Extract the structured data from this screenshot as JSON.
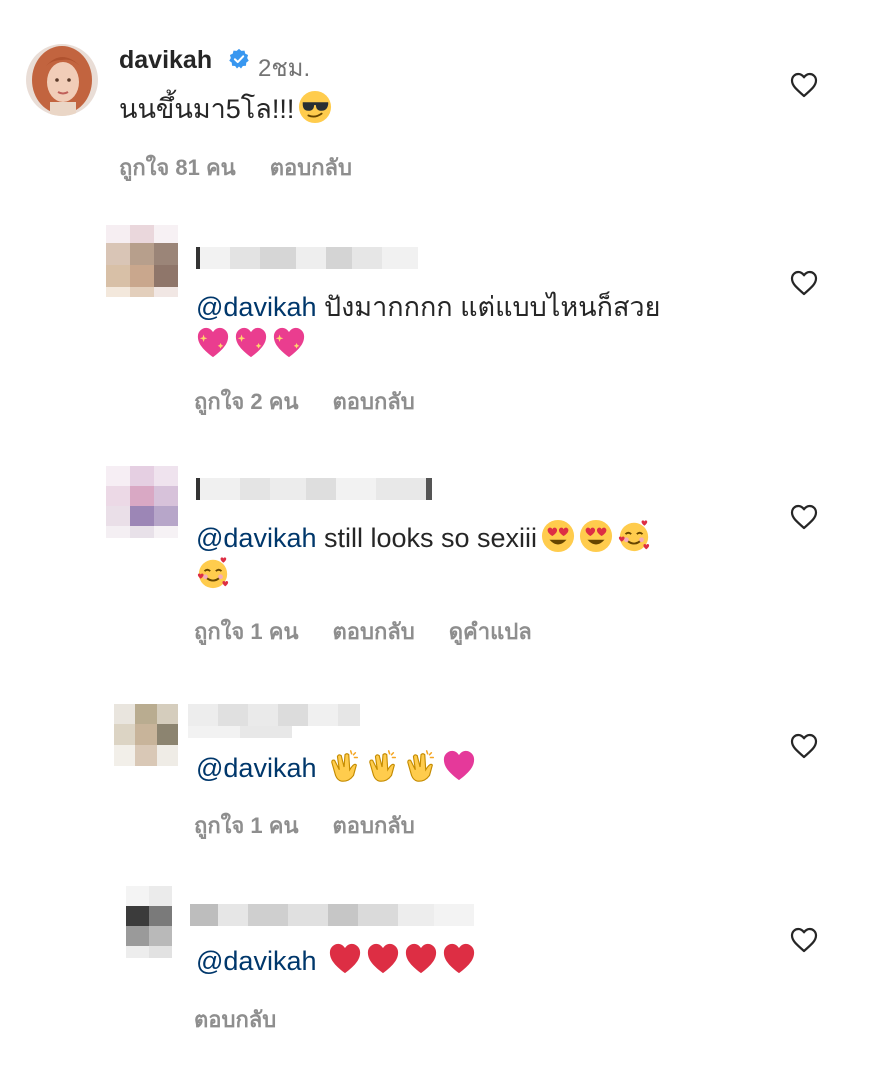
{
  "icons": {
    "like": "heart-outline-icon",
    "verified": "verified-badge-icon"
  },
  "colors": {
    "mention": "#00376b",
    "meta": "#8e8e8e",
    "verified": "#3897f0"
  },
  "comments": [
    {
      "username": "davikah",
      "time": "2ชม.",
      "text": "นนขึ้นมา5โล!!!",
      "emojis": [
        "smiling-face-with-sunglasses"
      ],
      "likes": "ถูกใจ 81 คน",
      "reply": "ตอบกลับ"
    },
    {
      "mention": "@davikah",
      "text": " ปังมากกกก แต่แบบไหนก็สวย",
      "emojis": [
        "sparkling-heart",
        "sparkling-heart",
        "sparkling-heart"
      ],
      "likes": "ถูกใจ 2 คน",
      "reply": "ตอบกลับ"
    },
    {
      "mention": "@davikah",
      "text": " still looks so sexiii",
      "emojis": [
        "heart-eyes",
        "heart-eyes",
        "smiling-face-with-hearts",
        "smiling-face-with-hearts"
      ],
      "likes": "ถูกใจ 1 คน",
      "reply": "ตอบกลับ",
      "translate": "ดูคำแปล"
    },
    {
      "mention": "@davikah",
      "emojis": [
        "clapping-hands",
        "clapping-hands",
        "clapping-hands",
        "pink-heart"
      ],
      "likes": "ถูกใจ 1 คน",
      "reply": "ตอบกลับ"
    },
    {
      "mention": "@davikah",
      "emojis": [
        "red-heart",
        "red-heart",
        "red-heart",
        "red-heart"
      ],
      "reply": "ตอบกลับ"
    }
  ]
}
